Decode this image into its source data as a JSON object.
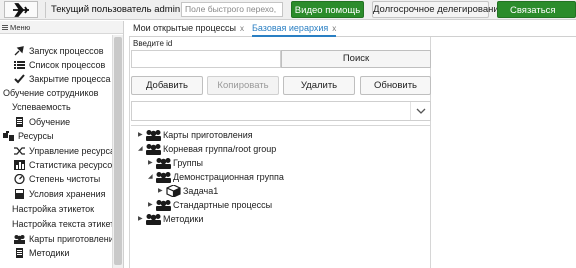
{
  "topbar": {
    "current_user": "Текущий пользователь admin",
    "quick_search_placeholder": "Поле быстрого перехо,",
    "video_help": "Видео помощь",
    "delegation": "Долгосрочное делегирование",
    "contact": "Связаться",
    "accent": "#2b8c2b"
  },
  "sidebar": {
    "header": "Меню",
    "items": [
      {
        "label": "Запуск процессов",
        "icon": "launch-icon"
      },
      {
        "label": "Список процессов",
        "icon": "list-icon"
      },
      {
        "label": "Закрытие процесса",
        "icon": "check-icon"
      },
      {
        "label": "Обучение сотрудников"
      },
      {
        "label": "Успеваемость"
      },
      {
        "label": "Обучение",
        "icon": "document-icon"
      },
      {
        "label": "Ресурсы",
        "icon": "resources-icon"
      },
      {
        "label": "Управление ресурсами",
        "icon": "shuffle-icon"
      },
      {
        "label": "Статистика ресурсов",
        "icon": "stats-icon"
      },
      {
        "label": "Степень чистоты",
        "icon": "gauge-icon"
      },
      {
        "label": "Условия хранения",
        "icon": "storage-icon"
      },
      {
        "label": "Настройка этикеток"
      },
      {
        "label": "Настройка текста этикетки"
      },
      {
        "label": "Карты приготовления",
        "icon": "group-icon"
      },
      {
        "label": "Методики",
        "icon": "document-icon"
      }
    ]
  },
  "tabs": [
    {
      "label": "Мои открытые процессы",
      "close": "x"
    },
    {
      "label": "Базовая иерархия",
      "close": "x",
      "active": true
    }
  ],
  "form": {
    "enter_id_label": "Введите id",
    "id_value": "",
    "search_button": "Поиск",
    "add_button": "Добавить",
    "copy_button": "Копировать",
    "delete_button": "Удалить",
    "refresh_button": "Обновить",
    "filter_value": ""
  },
  "tree": [
    {
      "label": "Карты приготовления",
      "expanded": false,
      "level": 0,
      "icon": "group-icon"
    },
    {
      "label": "Корневая группа/root group",
      "expanded": true,
      "level": 0,
      "icon": "group-icon"
    },
    {
      "label": "Группы",
      "expanded": false,
      "level": 1,
      "icon": "group-icon"
    },
    {
      "label": "Демонстрационная группа",
      "expanded": true,
      "level": 1,
      "icon": "group-icon"
    },
    {
      "label": "Задача1",
      "expanded": false,
      "level": 2,
      "icon": "cube-icon"
    },
    {
      "label": "Стандартные процессы",
      "expanded": false,
      "level": 1,
      "icon": "group-icon"
    },
    {
      "label": "Методики",
      "expanded": false,
      "level": 0,
      "icon": "group-icon"
    }
  ]
}
